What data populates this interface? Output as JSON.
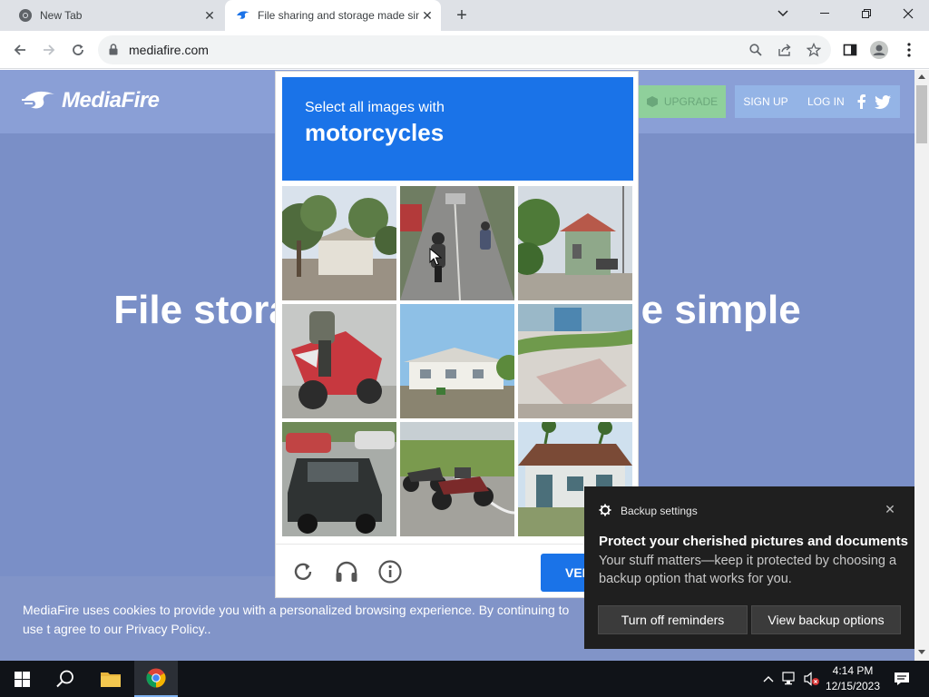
{
  "browser": {
    "tabs": [
      {
        "title": "New Tab",
        "active": false
      },
      {
        "title": "File sharing and storage made simple",
        "active": true
      }
    ],
    "address": "mediafire.com"
  },
  "site": {
    "logo": "MediaFire",
    "nav": {
      "upgrade": "UPGRADE",
      "signup": "SIGN UP",
      "login": "LOG IN"
    },
    "hero_left": "File storag",
    "hero_right": "de simple",
    "cookie_text": "MediaFire uses cookies to provide you with a personalized browsing experience. By continuing to use t agree to our Privacy Policy.."
  },
  "captcha": {
    "instruction": "Select all images with",
    "object": "motorcycles",
    "verify_label": "VERIFY",
    "verify_visible": "VER"
  },
  "notification": {
    "app": "Backup settings",
    "title": "Protect your cherished pictures and documents",
    "body": "Your stuff matters—keep it protected by choosing a backup option that works for you.",
    "buttons": [
      "Turn off reminders",
      "View backup options"
    ]
  },
  "taskbar": {
    "time": "4:14 PM",
    "date": "12/15/2023"
  },
  "colors": {
    "captcha_blue": "#1a73e8",
    "page_overlay": "#7a8fc7",
    "toast_bg": "#1f1f1f"
  }
}
